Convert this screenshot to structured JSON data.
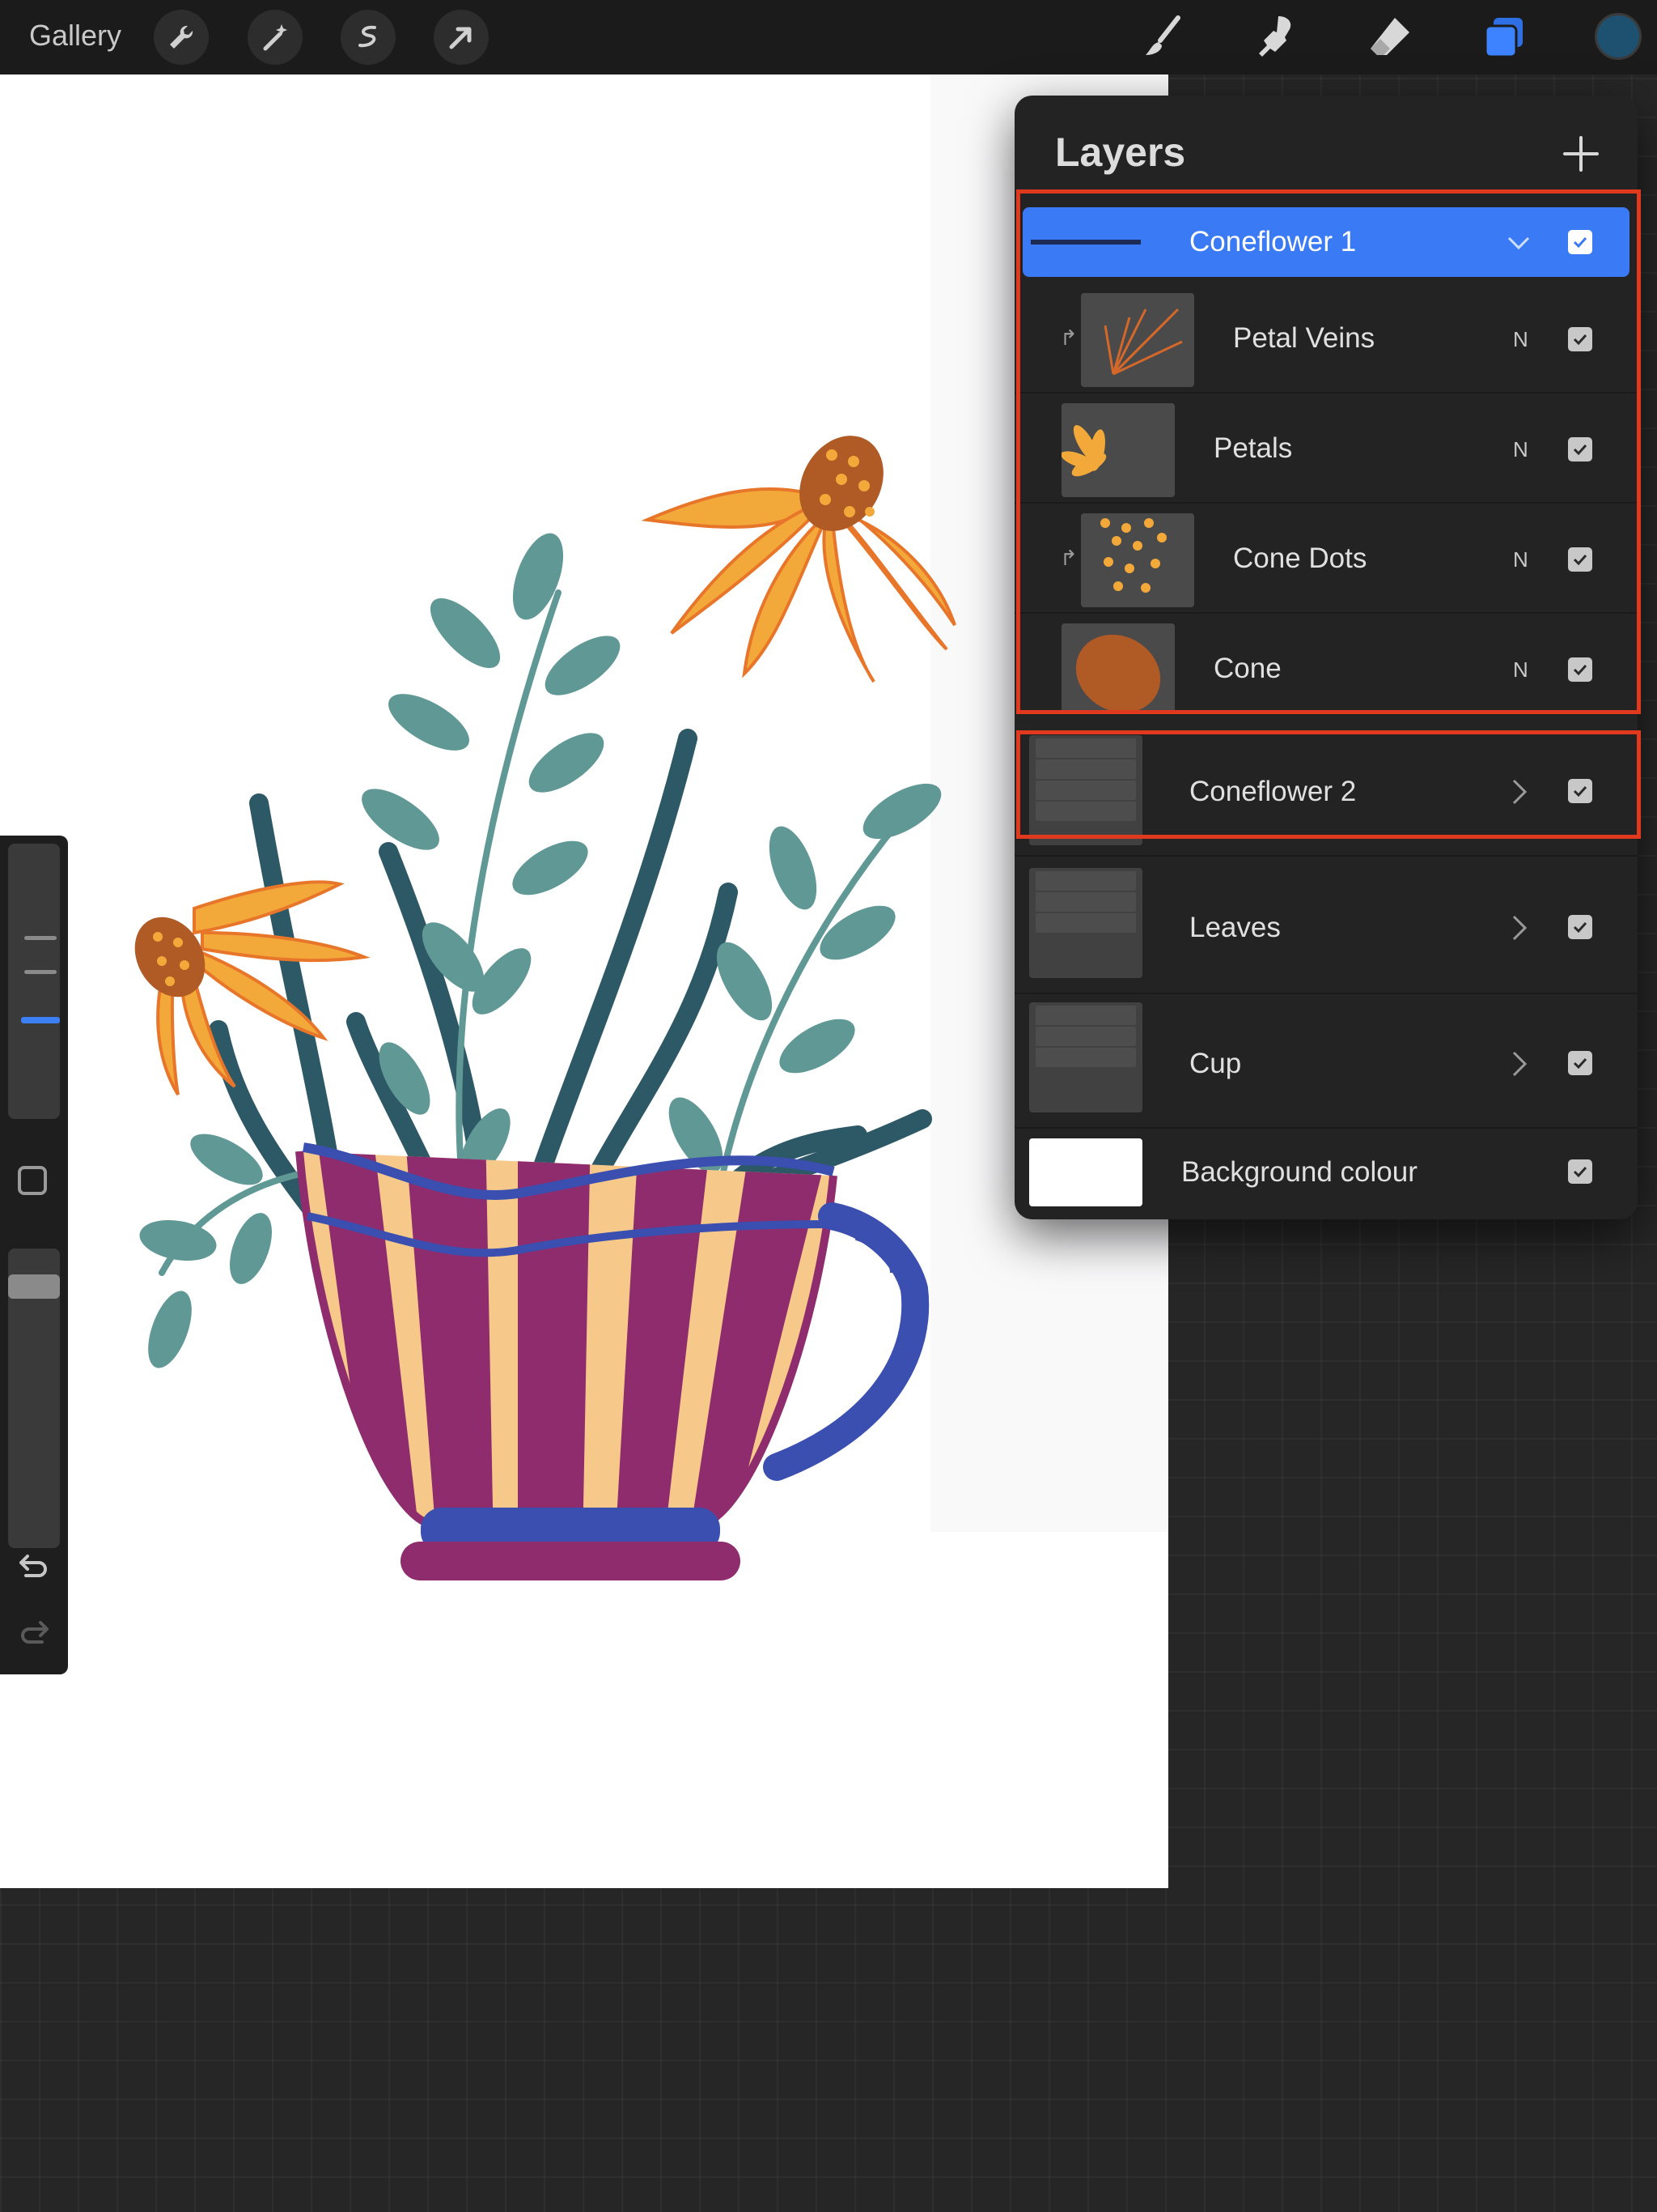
{
  "topbar": {
    "gallery_label": "Gallery",
    "left_tools": [
      "wrench-icon",
      "magic-wand-icon",
      "selection-icon",
      "transform-arrow-icon"
    ],
    "right_tools": [
      "brush-icon",
      "smudge-icon",
      "eraser-icon",
      "layers-icon"
    ],
    "current_colour": "#1e5070"
  },
  "layers_panel": {
    "title": "Layers",
    "add_icon": "plus-icon",
    "groups": [
      {
        "name": "Coneflower 1",
        "expanded": true,
        "selected": true,
        "visible": true,
        "children": [
          {
            "name": "Petal Veins",
            "mode": "N",
            "clipped": true,
            "visible": true
          },
          {
            "name": "Petals",
            "mode": "N",
            "clipped": false,
            "visible": true
          },
          {
            "name": "Cone Dots",
            "mode": "N",
            "clipped": true,
            "visible": true
          },
          {
            "name": "Cone",
            "mode": "N",
            "clipped": false,
            "visible": true
          }
        ]
      },
      {
        "name": "Coneflower 2",
        "expanded": false,
        "visible": true
      },
      {
        "name": "Leaves",
        "expanded": false,
        "visible": true
      },
      {
        "name": "Cup",
        "expanded": false,
        "visible": true
      }
    ],
    "background": {
      "name": "Background colour",
      "visible": true
    }
  },
  "colors": {
    "selection_blue": "#3a7af5",
    "highlight_red": "#e0391e",
    "petal_orange": "#f3a93a",
    "cone_brown": "#b05a26",
    "leaf_teal": "#5f9894",
    "leaf_dark": "#2d5866",
    "cup_purple": "#8e2c6e",
    "cup_cream": "#f6c98a",
    "cup_blue": "#3a4fb0"
  }
}
